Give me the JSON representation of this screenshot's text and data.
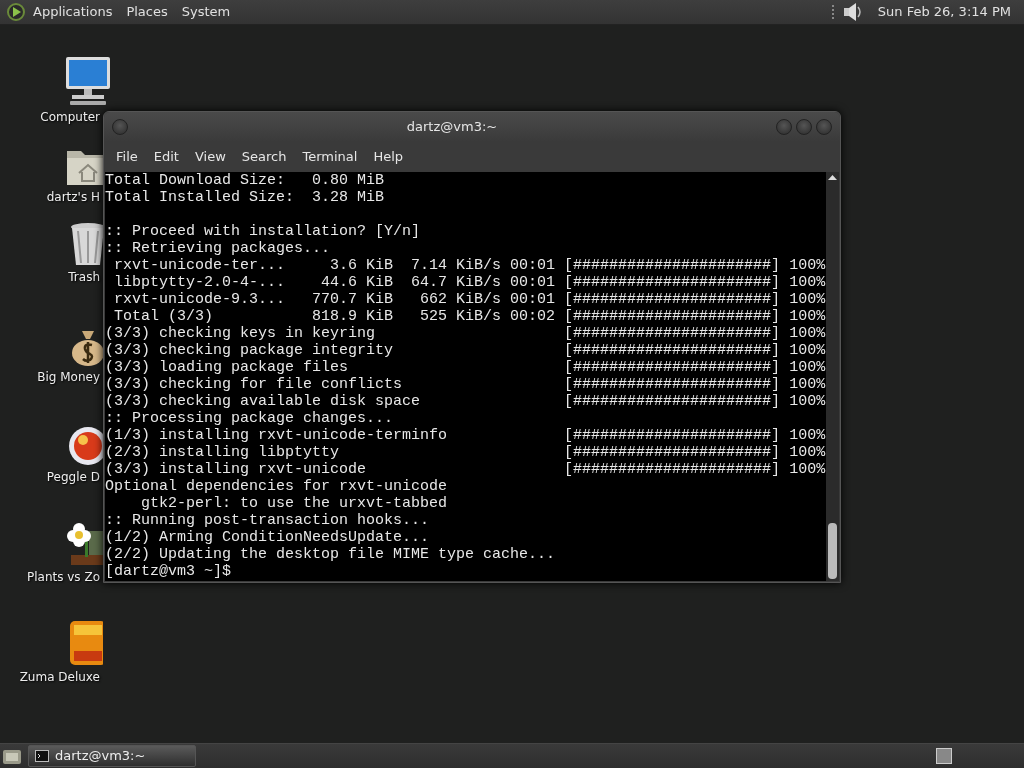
{
  "top_panel": {
    "menus": [
      "Applications",
      "Places",
      "System"
    ],
    "clock": "Sun Feb 26, 3:14 PM"
  },
  "desktop_icons": [
    {
      "kind": "computer",
      "label": "Computer"
    },
    {
      "kind": "home",
      "label": "dartz's H"
    },
    {
      "kind": "trash",
      "label": "Trash"
    },
    {
      "kind": "money",
      "label": "Big Money"
    },
    {
      "kind": "ball",
      "label": "Peggle D"
    },
    {
      "kind": "flower",
      "label": "Plants vs Zo"
    },
    {
      "kind": "tile",
      "label": "Zuma Deluxe"
    }
  ],
  "window": {
    "title": "dartz@vm3:~",
    "menu": [
      "File",
      "Edit",
      "View",
      "Search",
      "Terminal",
      "Help"
    ],
    "terminal_lines": [
      {
        "kind": "text",
        "text": "Total Download Size:   0.80 MiB"
      },
      {
        "kind": "text",
        "text": "Total Installed Size:  3.28 MiB"
      },
      {
        "kind": "blank"
      },
      {
        "kind": "text",
        "text": ":: Proceed with installation? [Y/n]"
      },
      {
        "kind": "text",
        "text": ":: Retrieving packages..."
      },
      {
        "kind": "progress",
        "text": " rxvt-unicode-ter...     3.6 KiB  7.14 KiB/s 00:01",
        "bar": "[######################]",
        "percent": "100%"
      },
      {
        "kind": "progress",
        "text": " libptytty-2.0-4-...    44.6 KiB  64.7 KiB/s 00:01",
        "bar": "[######################]",
        "percent": "100%"
      },
      {
        "kind": "progress",
        "text": " rxvt-unicode-9.3...   770.7 KiB   662 KiB/s 00:01",
        "bar": "[######################]",
        "percent": "100%"
      },
      {
        "kind": "progress",
        "text": " Total (3/3)           818.9 KiB   525 KiB/s 00:02",
        "bar": "[######################]",
        "percent": "100%"
      },
      {
        "kind": "progress",
        "text": "(3/3) checking keys in keyring",
        "bar": "[######################]",
        "percent": "100%"
      },
      {
        "kind": "progress",
        "text": "(3/3) checking package integrity",
        "bar": "[######################]",
        "percent": "100%"
      },
      {
        "kind": "progress",
        "text": "(3/3) loading package files",
        "bar": "[######################]",
        "percent": "100%"
      },
      {
        "kind": "progress",
        "text": "(3/3) checking for file conflicts",
        "bar": "[######################]",
        "percent": "100%"
      },
      {
        "kind": "progress",
        "text": "(3/3) checking available disk space",
        "bar": "[######################]",
        "percent": "100%"
      },
      {
        "kind": "text",
        "text": ":: Processing package changes..."
      },
      {
        "kind": "progress",
        "text": "(1/3) installing rxvt-unicode-terminfo",
        "bar": "[######################]",
        "percent": "100%"
      },
      {
        "kind": "progress",
        "text": "(2/3) installing libptytty",
        "bar": "[######################]",
        "percent": "100%"
      },
      {
        "kind": "progress",
        "text": "(3/3) installing rxvt-unicode",
        "bar": "[######################]",
        "percent": "100%"
      },
      {
        "kind": "text",
        "text": "Optional dependencies for rxvt-unicode"
      },
      {
        "kind": "text",
        "text": "    gtk2-perl: to use the urxvt-tabbed"
      },
      {
        "kind": "text",
        "text": ":: Running post-transaction hooks..."
      },
      {
        "kind": "text",
        "text": "(1/2) Arming ConditionNeedsUpdate..."
      },
      {
        "kind": "text",
        "text": "(2/2) Updating the desktop file MIME type cache..."
      },
      {
        "kind": "prompt",
        "text": "[dartz@vm3 ~]$"
      }
    ]
  },
  "taskbar": {
    "items": [
      {
        "label": "dartz@vm3:~",
        "selected": true
      }
    ]
  }
}
